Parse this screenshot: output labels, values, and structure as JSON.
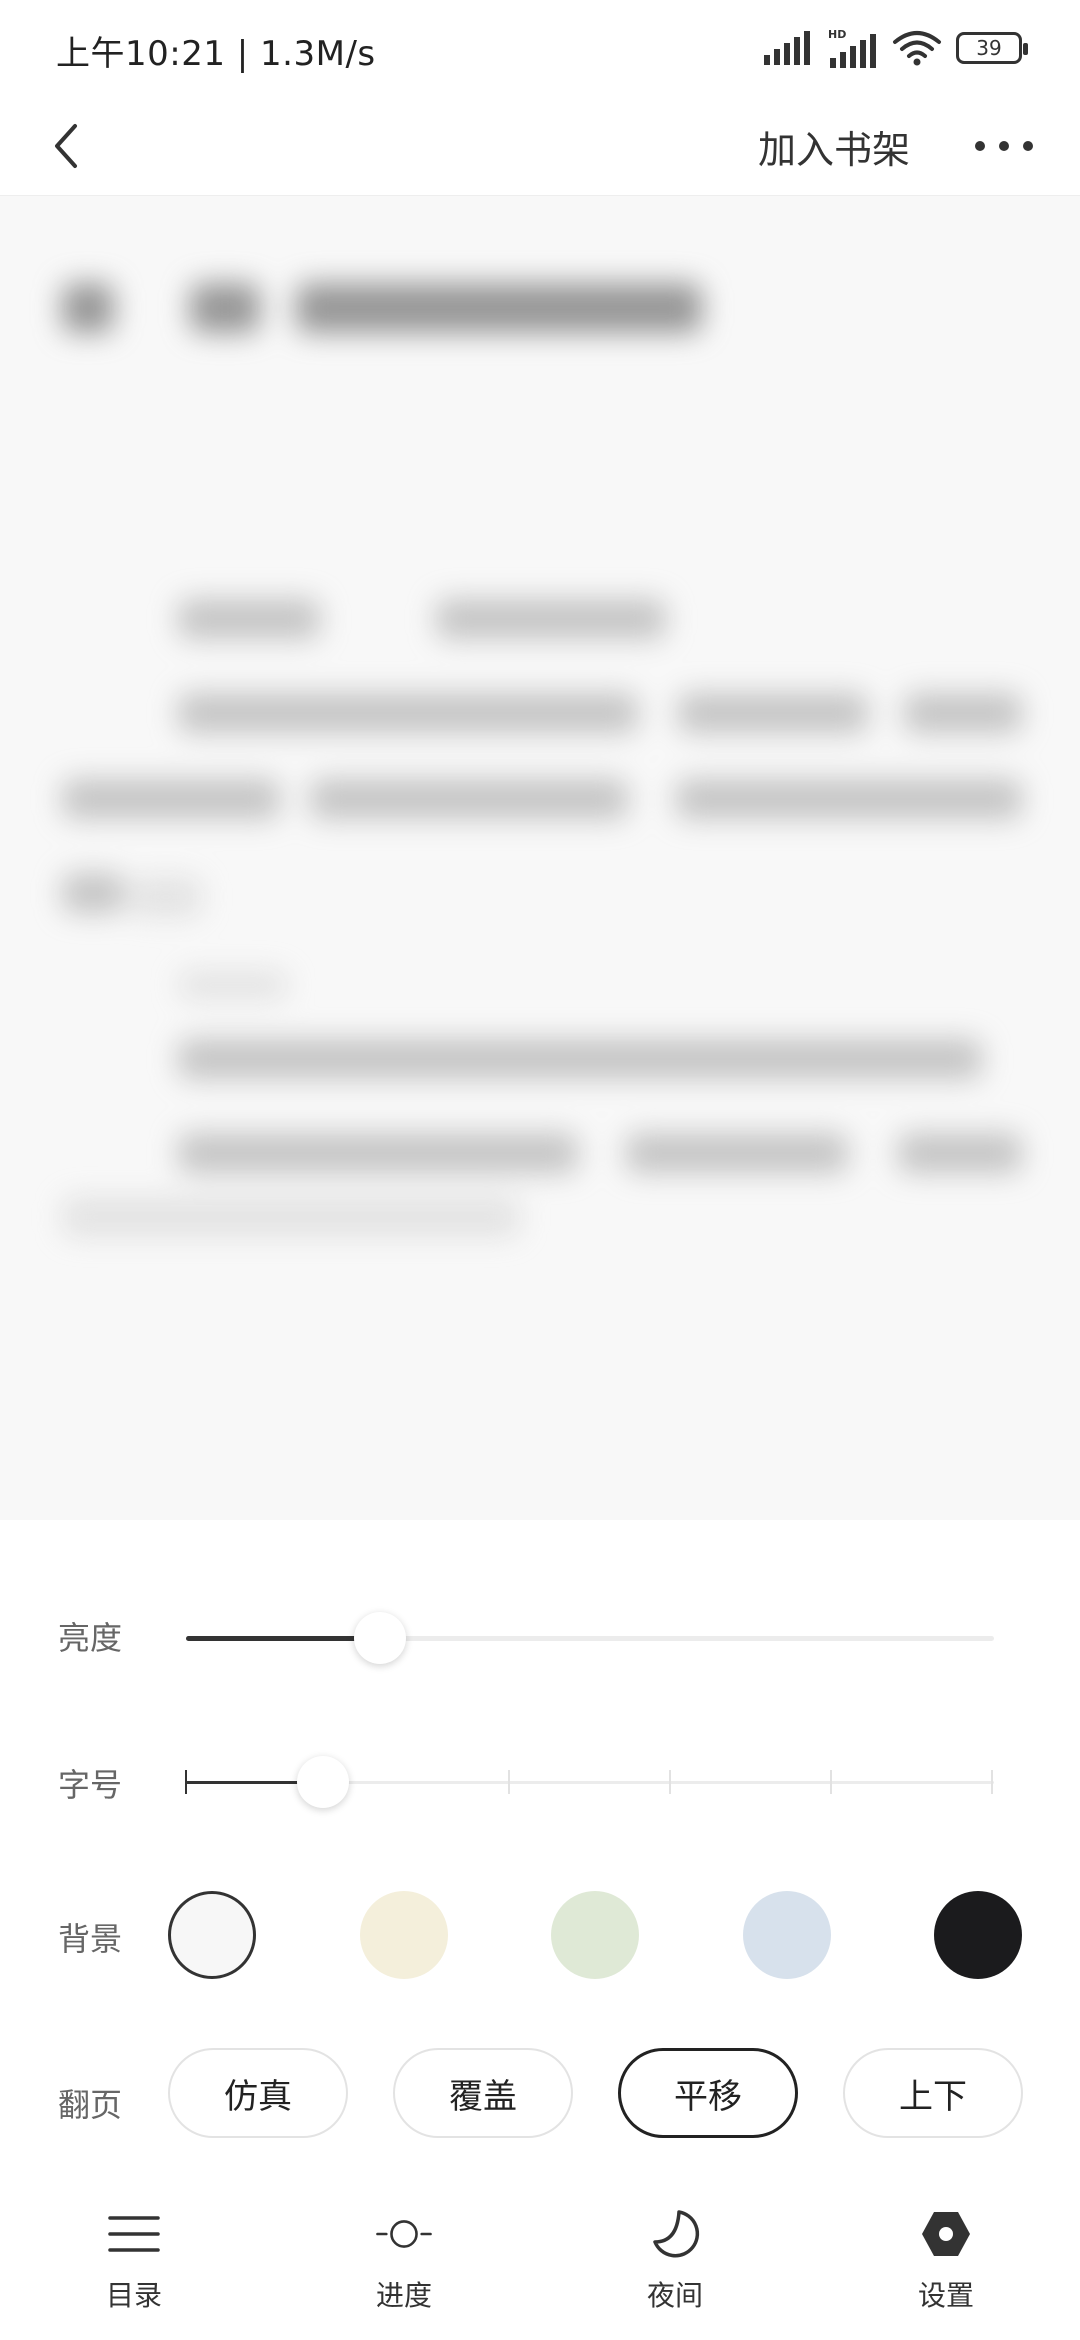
{
  "status_bar": {
    "time_speed": "上午10:21 | 1.3M/s",
    "battery": "39"
  },
  "app_bar": {
    "add_to_shelf": "加入书架"
  },
  "settings": {
    "brightness_label": "亮度",
    "brightness_level": 0.24,
    "font_size_label": "字号",
    "font_size_level": 0.17,
    "background_label": "背景",
    "backgrounds": [
      {
        "color": "#f7f7f7",
        "selected": true
      },
      {
        "color": "#f4efdb",
        "selected": false
      },
      {
        "color": "#dfe9d6",
        "selected": false
      },
      {
        "color": "#d7e1ec",
        "selected": false
      },
      {
        "color": "#1b1b1d",
        "selected": false
      }
    ],
    "page_turn_label": "翻页",
    "page_turn_options": [
      {
        "label": "仿真",
        "selected": false
      },
      {
        "label": "覆盖",
        "selected": false
      },
      {
        "label": "平移",
        "selected": true
      },
      {
        "label": "上下",
        "selected": false
      }
    ]
  },
  "bottom_nav": [
    {
      "label": "目录",
      "icon": "menu-icon"
    },
    {
      "label": "进度",
      "icon": "progress-icon"
    },
    {
      "label": "夜间",
      "icon": "moon-icon"
    },
    {
      "label": "设置",
      "icon": "settings-icon"
    }
  ]
}
